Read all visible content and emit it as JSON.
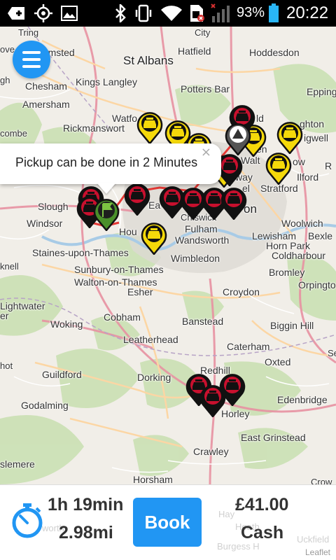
{
  "status_bar": {
    "battery_percent": "93%",
    "time": "20:22",
    "icons": [
      "add-box-icon",
      "gps-icon",
      "image-icon",
      "bluetooth-icon",
      "vibrate-icon",
      "wifi-icon",
      "sim-error-icon",
      "signal-icon",
      "battery-icon"
    ]
  },
  "map": {
    "places": [
      {
        "id": "tring",
        "text": "Tring"
      },
      {
        "id": "city",
        "text": "City"
      },
      {
        "id": "hemel",
        "text": "khamsted"
      },
      {
        "id": "stalbans",
        "text": "St Albans"
      },
      {
        "id": "hatfield",
        "text": "Hatfield"
      },
      {
        "id": "hoddesdon",
        "text": "Hoddesdon"
      },
      {
        "id": "chesham",
        "text": "Chesham"
      },
      {
        "id": "kingslangley",
        "text": "Kings Langley"
      },
      {
        "id": "pottersbar",
        "text": "Potters Bar"
      },
      {
        "id": "epping",
        "text": "Epping"
      },
      {
        "id": "amersham",
        "text": "Amersham"
      },
      {
        "id": "watford",
        "text": "Watfo"
      },
      {
        "id": "rickmansworth",
        "text": "Rickmanswort"
      },
      {
        "id": "combe",
        "text": "combe"
      },
      {
        "id": "loughton",
        "text": "ghton"
      },
      {
        "id": "chigwell",
        "text": "igwell"
      },
      {
        "id": "stratford",
        "text": "Stratford"
      },
      {
        "id": "ilford",
        "text": "Ilford"
      },
      {
        "id": "slough",
        "text": "Slough"
      },
      {
        "id": "windsor",
        "text": "Windsor"
      },
      {
        "id": "hounslow",
        "text": "Hou"
      },
      {
        "id": "chiswick",
        "text": "Chiswick"
      },
      {
        "id": "fulham",
        "text": "Fulham"
      },
      {
        "id": "wandsworth",
        "text": "Wandsworth"
      },
      {
        "id": "woolwich",
        "text": "Woolwich"
      },
      {
        "id": "lewisham",
        "text": "Lewisham"
      },
      {
        "id": "bexley",
        "text": "Bexle"
      },
      {
        "id": "hornpark",
        "text": "Horn Park"
      },
      {
        "id": "coldharbour",
        "text": "Coldharbour"
      },
      {
        "id": "staines",
        "text": "Staines-upon-Thames"
      },
      {
        "id": "sunbury",
        "text": "Sunbury-on-Thames"
      },
      {
        "id": "walton",
        "text": "Walton-on-Thames"
      },
      {
        "id": "wimbledon",
        "text": "Wimbledon"
      },
      {
        "id": "bromley",
        "text": "Bromley"
      },
      {
        "id": "orpington",
        "text": "Orpingto"
      },
      {
        "id": "esher",
        "text": "Esher"
      },
      {
        "id": "croydon",
        "text": "Croydon"
      },
      {
        "id": "knell",
        "text": "knell"
      },
      {
        "id": "lightwater",
        "text": "Lightwater"
      },
      {
        "id": "er",
        "text": "er"
      },
      {
        "id": "woking",
        "text": "Woking"
      },
      {
        "id": "cobham",
        "text": "Cobham"
      },
      {
        "id": "banstead",
        "text": "Banstead"
      },
      {
        "id": "bigginhill",
        "text": "Biggin Hill"
      },
      {
        "id": "leatherhead",
        "text": "Leatherhead"
      },
      {
        "id": "caterham",
        "text": "Caterham"
      },
      {
        "id": "oxted",
        "text": "Oxted"
      },
      {
        "id": "hot",
        "text": "hot"
      },
      {
        "id": "guildford",
        "text": "Guildford"
      },
      {
        "id": "dorking",
        "text": "Dorking"
      },
      {
        "id": "redhill",
        "text": "Redhill"
      },
      {
        "id": "se",
        "text": "Se"
      },
      {
        "id": "godalming",
        "text": "Godalming"
      },
      {
        "id": "edenbridge",
        "text": "Edenbridge"
      },
      {
        "id": "horley",
        "text": "Horley"
      },
      {
        "id": "eastgrinstead",
        "text": "East Grinstead"
      },
      {
        "id": "crawley",
        "text": "Crawley"
      },
      {
        "id": "slemere",
        "text": "slemere"
      },
      {
        "id": "horsham",
        "text": "Horsham"
      },
      {
        "id": "crow",
        "text": "Crow"
      },
      {
        "id": "ow",
        "text": "ow"
      },
      {
        "id": "gh",
        "text": "gh"
      },
      {
        "id": "ove",
        "text": "ove"
      },
      {
        "id": "ea",
        "text": "Ea"
      },
      {
        "id": "on",
        "text": "on"
      },
      {
        "id": "ld",
        "text": "ld"
      },
      {
        "id": "r",
        "text": "R"
      },
      {
        "id": "way",
        "text": "way"
      },
      {
        "id": "el",
        "text": "el"
      },
      {
        "id": "en",
        "text": "en"
      },
      {
        "id": "walt",
        "text": "Walt"
      }
    ],
    "pickup_popup": {
      "text": "Pickup can be done in 2 Minutes",
      "close": "×"
    }
  },
  "bottom_panel": {
    "duration": "1h 19min",
    "distance": "2.98mi",
    "book_label": "Book",
    "price": "£41.00",
    "payment": "Cash",
    "attribution": "Leaflet",
    "bg_labels": [
      "Hay",
      "Heath",
      "Burgess H",
      "Uckfield",
      "worth"
    ]
  },
  "colors": {
    "accent": "#2196f3",
    "taxi_yellow": "#f5d90a",
    "pin_red": "#c8102e",
    "route_red": "#e53935"
  }
}
